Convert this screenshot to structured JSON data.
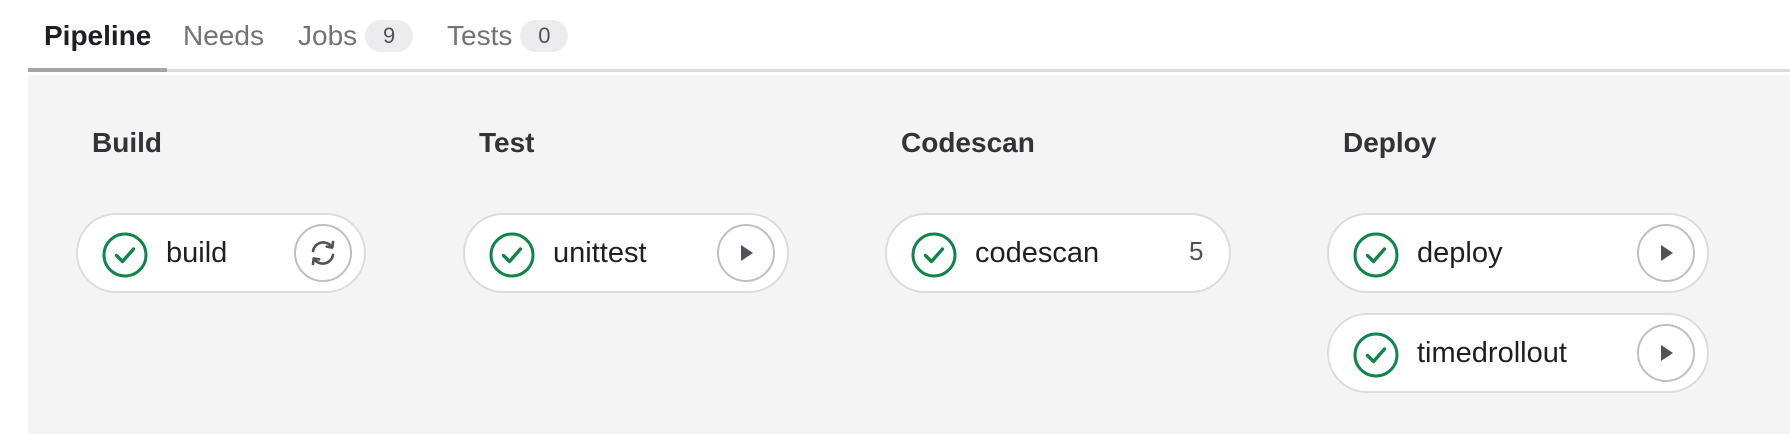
{
  "tabs": [
    {
      "label": "Pipeline",
      "badge": null,
      "active": true
    },
    {
      "label": "Needs",
      "badge": null,
      "active": false
    },
    {
      "label": "Jobs",
      "badge": "9",
      "active": false
    },
    {
      "label": "Tests",
      "badge": "0",
      "active": false
    }
  ],
  "stages": [
    {
      "title": "Build"
    },
    {
      "title": "Test"
    },
    {
      "title": "Codescan"
    },
    {
      "title": "Deploy"
    }
  ],
  "jobs": {
    "build": {
      "name": "build",
      "status": "success",
      "action": "retry-icon"
    },
    "unittest": {
      "name": "unittest",
      "status": "success",
      "action": "play-icon"
    },
    "codescan": {
      "name": "codescan",
      "status": "success",
      "count": "5"
    },
    "deploy": {
      "name": "deploy",
      "status": "success",
      "action": "play-icon"
    },
    "timedrollout": {
      "name": "timedrollout",
      "status": "success",
      "action": "play-icon"
    }
  },
  "colors": {
    "success": "#108548",
    "icon_gray": "#535158",
    "background": "#f4f4f4"
  }
}
